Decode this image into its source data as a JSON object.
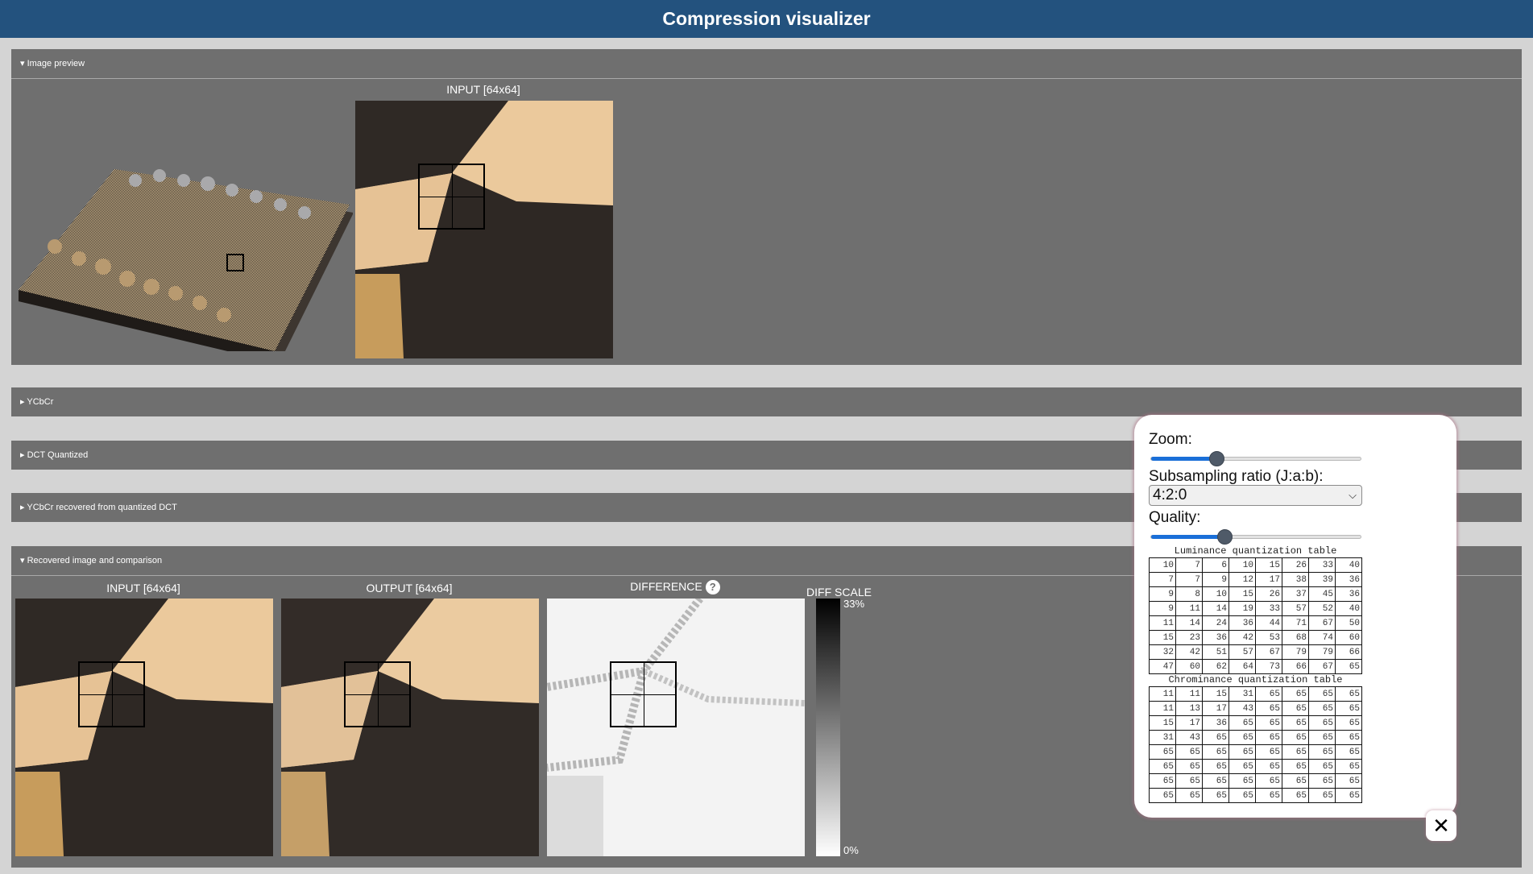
{
  "header": {
    "title": "Compression visualizer"
  },
  "sections": {
    "image_preview": {
      "label": "▾ Image preview",
      "input_label": "INPUT [64x64]"
    },
    "ycbcr": {
      "label": "▸ YCbCr"
    },
    "dct_quantized": {
      "label": "▸ DCT Quantized"
    },
    "ycbcr_recovered": {
      "label": "▸ YCbCr recovered from quantized DCT"
    },
    "recovered": {
      "label": "▾ Recovered image and comparison",
      "input_label": "INPUT [64x64]",
      "output_label": "OUTPUT [64x64]",
      "difference_label": "DIFFERENCE",
      "help_icon": "?",
      "diff_scale_label": "DIFF SCALE",
      "scale_max": "33%",
      "scale_min": "0%"
    }
  },
  "controls": {
    "zoom_label": "Zoom:",
    "zoom_value": 0.31,
    "subsampling_label": "Subsampling ratio (J:a:b):",
    "subsampling_value": "4:2:0",
    "quality_label": "Quality:",
    "quality_value": 0.35,
    "luminance_title": "Luminance quantization table",
    "luminance": [
      [
        10,
        7,
        6,
        10,
        15,
        26,
        33,
        40
      ],
      [
        7,
        7,
        9,
        12,
        17,
        38,
        39,
        36
      ],
      [
        9,
        8,
        10,
        15,
        26,
        37,
        45,
        36
      ],
      [
        9,
        11,
        14,
        19,
        33,
        57,
        52,
        40
      ],
      [
        11,
        14,
        24,
        36,
        44,
        71,
        67,
        50
      ],
      [
        15,
        23,
        36,
        42,
        53,
        68,
        74,
        60
      ],
      [
        32,
        42,
        51,
        57,
        67,
        79,
        79,
        66
      ],
      [
        47,
        60,
        62,
        64,
        73,
        66,
        67,
        65
      ]
    ],
    "chrominance_title": "Chrominance quantization table",
    "chrominance": [
      [
        11,
        11,
        15,
        31,
        65,
        65,
        65,
        65
      ],
      [
        11,
        13,
        17,
        43,
        65,
        65,
        65,
        65
      ],
      [
        15,
        17,
        36,
        65,
        65,
        65,
        65,
        65
      ],
      [
        31,
        43,
        65,
        65,
        65,
        65,
        65,
        65
      ],
      [
        65,
        65,
        65,
        65,
        65,
        65,
        65,
        65
      ],
      [
        65,
        65,
        65,
        65,
        65,
        65,
        65,
        65
      ],
      [
        65,
        65,
        65,
        65,
        65,
        65,
        65,
        65
      ],
      [
        65,
        65,
        65,
        65,
        65,
        65,
        65,
        65
      ]
    ],
    "close_icon": "✕"
  },
  "colors": {
    "header": "#23527e",
    "section": "#6f6f6f",
    "accent": "#1a6fd8"
  }
}
